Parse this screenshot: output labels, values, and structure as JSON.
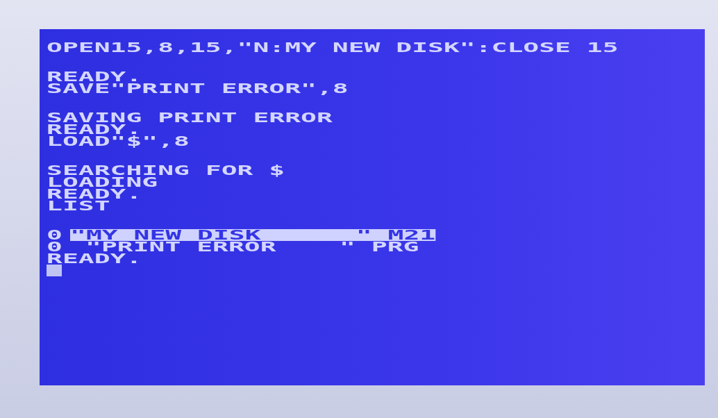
{
  "screen": {
    "paragraphs": [
      [
        "OPEN15,8,15,\"N:MY NEW DISK\":CLOSE 15"
      ],
      [
        "READY.",
        "SAVE\"PRINT ERROR\",8"
      ],
      [
        "SAVING PRINT ERROR",
        "READY.",
        "LOAD\"$\",8"
      ],
      [
        "SEARCHING FOR $",
        "LOADING",
        "READY.",
        "LIST"
      ]
    ],
    "directory": [
      {
        "kind": "header",
        "blocks": "0",
        "entry": "\"MY NEW DISK      \" M21"
      },
      {
        "kind": "file",
        "blocks": "0",
        "entry": "\"PRINT ERROR    \" PRG"
      }
    ],
    "prompt": "READY.",
    "cursor": {
      "visible": true
    }
  }
}
